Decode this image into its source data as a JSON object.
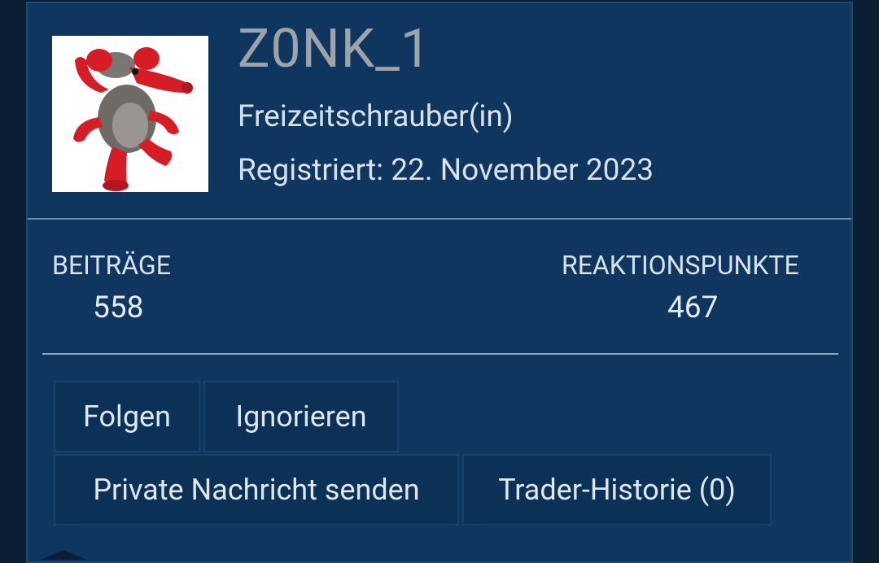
{
  "profile": {
    "username": "Z0NK_1",
    "user_title": "Freizeitschrauber(in)",
    "registered": "Registriert: 22. November 2023",
    "avatar_icon": "plush-mouse-avatar"
  },
  "stats": {
    "posts_label": "BEITRÄGE",
    "posts_value": "558",
    "reactions_label": "REAKTIONSPUNKTE",
    "reactions_value": "467"
  },
  "actions": {
    "follow": "Folgen",
    "ignore": "Ignorieren",
    "message": "Private Nachricht senden",
    "trader_history": "Trader-Historie (0)"
  },
  "colors": {
    "card_bg": "#0e365f",
    "page_bg": "#0b1e33",
    "button_bg": "#0c3157",
    "username": "#9da3a8",
    "text": "#d9e2ea"
  }
}
